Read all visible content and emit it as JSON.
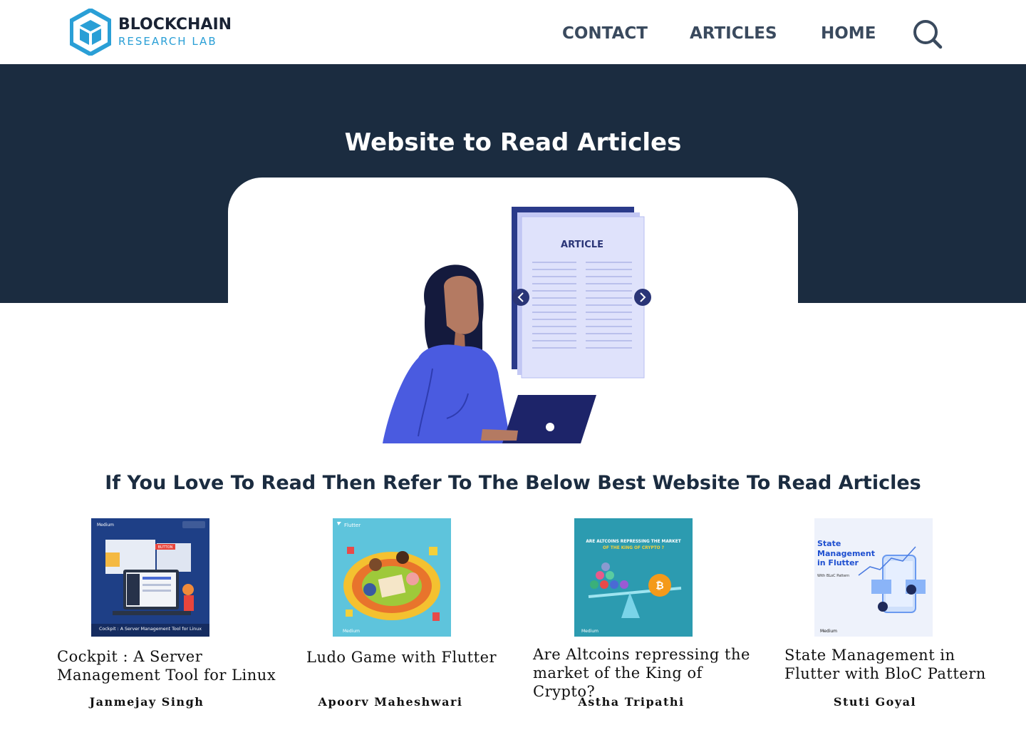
{
  "brand": {
    "line1": "BLOCKCHAIN",
    "line2": "RESEARCH LAB"
  },
  "nav": {
    "contact": "CONTACT",
    "articles": "ARTICLES",
    "home": "HOME",
    "search_icon": "search-icon"
  },
  "hero": {
    "title": "Website to Read Articles",
    "illustration_label": "ARTICLE"
  },
  "section": {
    "heading": "If You Love To Read Then Refer To The Below Best Website To Read Articles"
  },
  "articles": [
    {
      "title_line1": "Cockpit : A Server",
      "title_line2": "Management Tool for Linux",
      "author": "Janmejay Singh",
      "thumb_brand": "Medium",
      "thumb_caption": "Cockpit : A Server Management Tool for Linux",
      "thumb_button": "BUTTON",
      "thumb_bg": "#1a3a7a"
    },
    {
      "title_line1": "Ludo Game with Flutter",
      "title_line2": "",
      "author": "Apoorv Maheshwari",
      "thumb_brand": "Flutter",
      "thumb_footer": "Medium",
      "thumb_bg": "#5ec4dc"
    },
    {
      "title_line1": "Are Altcoins repressing the",
      "title_line2": "market of the King of Crypto?",
      "author": "Astha Tripathi",
      "thumb_headline1": "ARE ALTCOINS REPRESSING THE MARKET",
      "thumb_headline2": "OF THE KING OF CRYPTO ?",
      "thumb_footer": "Medium",
      "thumb_bg": "#2c9bb0"
    },
    {
      "title_line1": "State Management in",
      "title_line2": "Flutter with BloC Pattern",
      "author": "Stuti Goyal",
      "thumb_headline1": "State",
      "thumb_headline2": "Management",
      "thumb_headline3": "in Flutter",
      "thumb_sub": "With BLoC Pattern",
      "thumb_footer": "Medium",
      "thumb_bg": "#eef2fb"
    }
  ],
  "colors": {
    "hero_bg": "#1b2c40",
    "nav_text": "#3a4a5e",
    "brand_blue": "#2a9fd6",
    "illustration_blue": "#4a5be0"
  }
}
